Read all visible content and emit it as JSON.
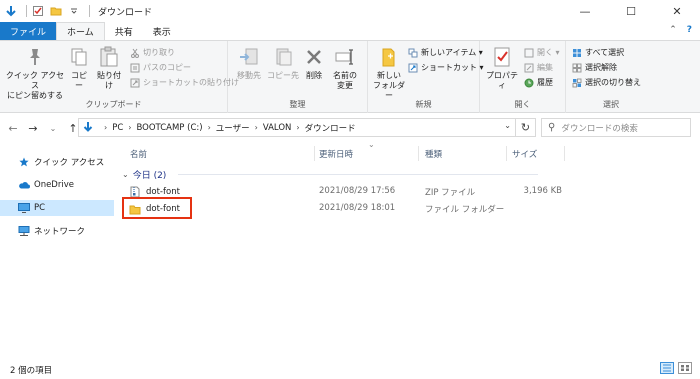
{
  "window": {
    "title": "ダウンロード",
    "minimize": "—",
    "maximize": "☐",
    "close": "✕"
  },
  "tabs": {
    "file": "ファイル",
    "home": "ホーム",
    "share": "共有",
    "view": "表示",
    "collapse": "⌃",
    "help": "?"
  },
  "ribbon": {
    "clipboard": {
      "label": "クリップボード",
      "pin": "クイック アクセス\nにピン留めする",
      "copy": "コピー",
      "paste": "貼り付け",
      "cut": "切り取り",
      "copy_path": "パスのコピー",
      "paste_shortcut": "ショートカットの貼り付け"
    },
    "organize": {
      "label": "整理",
      "move_to": "移動先",
      "copy_to": "コピー先",
      "delete": "削除",
      "rename": "名前の\n変更"
    },
    "new": {
      "label": "新規",
      "new_folder": "新しい\nフォルダー",
      "new_item": "新しいアイテム ▾",
      "shortcut": "ショートカット ▾"
    },
    "open": {
      "label": "開く",
      "properties": "プロパティ",
      "open": "開く ▾",
      "edit": "編集",
      "history": "履歴"
    },
    "select": {
      "label": "選択",
      "select_all": "すべて選択",
      "select_none": "選択解除",
      "invert": "選択の切り替え"
    }
  },
  "address": {
    "crumbs": [
      "PC",
      "BOOTCAMP (C:)",
      "ユーザー",
      "VALON",
      "ダウンロード"
    ],
    "search_placeholder": "ダウンロードの検索"
  },
  "nav": {
    "quick_access": "クイック アクセス",
    "onedrive": "OneDrive",
    "pc": "PC",
    "network": "ネットワーク"
  },
  "columns": {
    "name": "名前",
    "date": "更新日時",
    "type": "種類",
    "size": "サイズ"
  },
  "group": {
    "label": "今日 (2)"
  },
  "files": [
    {
      "name": "dot-font",
      "date": "2021/08/29 17:56",
      "type": "ZIP ファイル",
      "size": "3,196 KB"
    },
    {
      "name": "dot-font",
      "date": "2021/08/29 18:01",
      "type": "ファイル フォルダー",
      "size": ""
    }
  ],
  "status": {
    "count": "2 個の項目"
  },
  "colors": {
    "accent": "#1979ca",
    "highlight": "#e53212",
    "selection": "#cce8ff"
  }
}
